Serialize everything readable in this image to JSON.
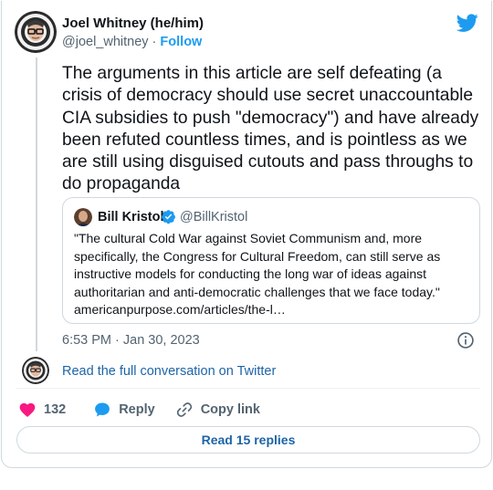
{
  "author": {
    "display_name": "Joel Whitney (he/him)",
    "handle": "@joel_whitney",
    "separator": " · ",
    "follow_label": "Follow"
  },
  "tweet": {
    "text": "The arguments in this article are self defeating (a crisis of democracy should use secret unaccountable CIA subsidies to push \"democracy\") and have already been refuted countless times, and is pointless as we are still using disguised cutouts and pass throughs to do propaganda",
    "timestamp": "6:53 PM · Jan 30, 2023"
  },
  "quoted": {
    "display_name": "Bill Kristol",
    "handle": "@BillKristol",
    "text": "\"The cultural Cold War against Soviet Communism and, more specifically, the Congress for Cultural Freedom, can still serve as instructive models for conducting the long war of ideas against authoritarian and anti-democratic challenges that we face today.\" americanpurpose.com/articles/the-l…"
  },
  "links": {
    "read_conversation": "Read the full conversation on Twitter",
    "read_replies": "Read 15 replies"
  },
  "actions": {
    "like_count": "132",
    "reply_label": "Reply",
    "copy_link_label": "Copy link"
  },
  "colors": {
    "twitter_blue": "#1d9bf0",
    "like_red": "#f91880",
    "link_blue": "#1d64a8",
    "border": "#cfd9de"
  },
  "icons": [
    "twitter-bird-icon",
    "verified-badge-icon",
    "info-icon",
    "heart-icon",
    "reply-bubble-icon",
    "link-icon"
  ]
}
